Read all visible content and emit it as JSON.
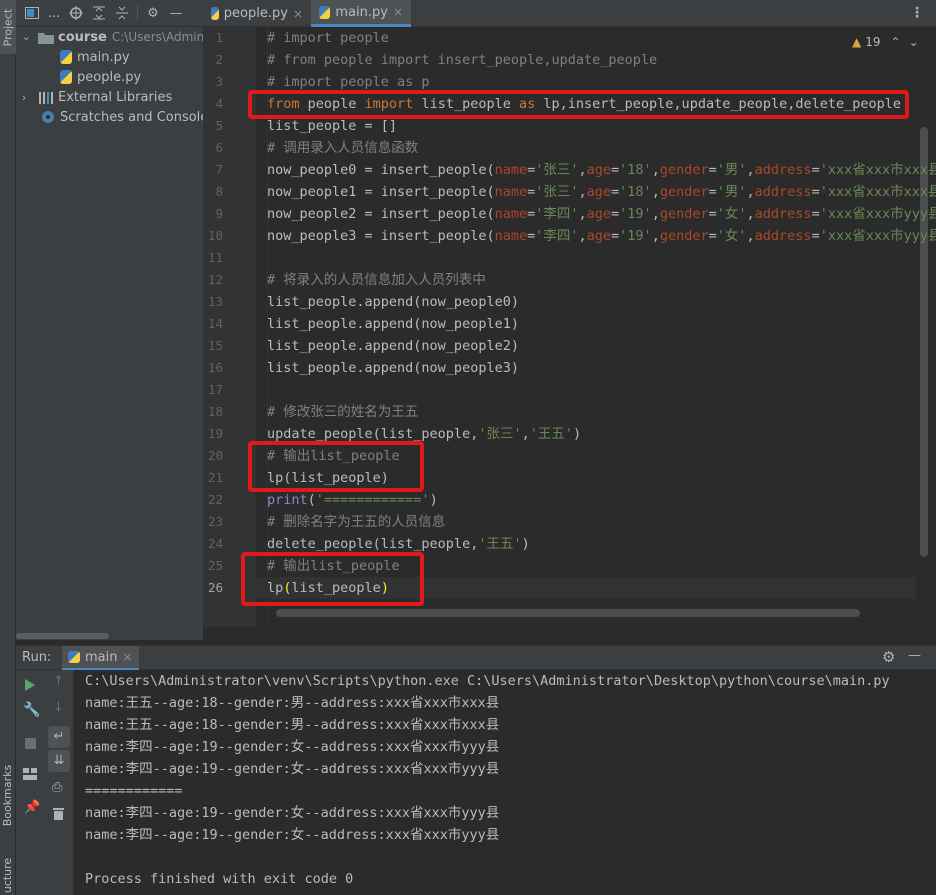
{
  "tool_strip": {
    "project_label": "Project",
    "bookmarks_label": "Bookmarks",
    "structure_label": "ucture"
  },
  "project": {
    "tree": [
      {
        "label": "course",
        "path": "C:\\Users\\Adminis"
      },
      {
        "label": "main.py"
      },
      {
        "label": "people.py"
      },
      {
        "label": "External Libraries"
      },
      {
        "label": "Scratches and Consoles"
      }
    ]
  },
  "editor": {
    "tabs": [
      {
        "label": "people.py"
      },
      {
        "label": "main.py"
      }
    ],
    "warnings_count": "19",
    "line_numbers": [
      "1",
      "2",
      "3",
      "4",
      "5",
      "6",
      "7",
      "8",
      "9",
      "10",
      "11",
      "12",
      "13",
      "14",
      "15",
      "16",
      "17",
      "18",
      "19",
      "20",
      "21",
      "22",
      "23",
      "24",
      "25",
      "26"
    ],
    "lines": [
      {
        "t": [
          [
            "cm",
            "# import people"
          ]
        ]
      },
      {
        "t": [
          [
            "cm",
            "# from people import insert_people,update_people"
          ]
        ]
      },
      {
        "t": [
          [
            "cm",
            "# import people as p"
          ]
        ]
      },
      {
        "t": [
          [
            "kw",
            "from "
          ],
          [
            "",
            "people "
          ],
          [
            "kw",
            "import "
          ],
          [
            "",
            "list_people "
          ],
          [
            "kw",
            "as "
          ],
          [
            "",
            "lp,insert_people,update_people,delete_people"
          ]
        ]
      },
      {
        "t": [
          [
            "",
            "list_people = []"
          ]
        ]
      },
      {
        "t": [
          [
            "cm",
            "# 调用录入人员信息函数"
          ]
        ]
      },
      {
        "t": [
          [
            "",
            "now_people0 = insert_people("
          ],
          [
            "pn",
            "name"
          ],
          [
            "",
            "="
          ],
          [
            "st",
            "'张三'"
          ],
          [
            "",
            ","
          ],
          [
            "pn",
            "age"
          ],
          [
            "",
            "="
          ],
          [
            "st",
            "'18'"
          ],
          [
            "",
            ","
          ],
          [
            "pn",
            "gender"
          ],
          [
            "",
            "="
          ],
          [
            "st",
            "'男'"
          ],
          [
            "",
            ","
          ],
          [
            "pn",
            "address"
          ],
          [
            "",
            "="
          ],
          [
            "st",
            "'xxx省xxx市xxx县"
          ]
        ]
      },
      {
        "t": [
          [
            "",
            "now_people1 = insert_people("
          ],
          [
            "pn",
            "name"
          ],
          [
            "",
            "="
          ],
          [
            "st",
            "'张三'"
          ],
          [
            "",
            ","
          ],
          [
            "pn",
            "age"
          ],
          [
            "",
            "="
          ],
          [
            "st",
            "'18'"
          ],
          [
            "",
            ","
          ],
          [
            "pn",
            "gender"
          ],
          [
            "",
            "="
          ],
          [
            "st",
            "'男'"
          ],
          [
            "",
            ","
          ],
          [
            "pn",
            "address"
          ],
          [
            "",
            "="
          ],
          [
            "st",
            "'xxx省xxx市xxx县"
          ]
        ]
      },
      {
        "t": [
          [
            "",
            "now_people2 = insert_people("
          ],
          [
            "pn",
            "name"
          ],
          [
            "",
            "="
          ],
          [
            "st",
            "'李四'"
          ],
          [
            "",
            ","
          ],
          [
            "pn",
            "age"
          ],
          [
            "",
            "="
          ],
          [
            "st",
            "'19'"
          ],
          [
            "",
            ","
          ],
          [
            "pn",
            "gender"
          ],
          [
            "",
            "="
          ],
          [
            "st",
            "'女'"
          ],
          [
            "",
            ","
          ],
          [
            "pn",
            "address"
          ],
          [
            "",
            "="
          ],
          [
            "st",
            "'xxx省xxx市yyy县"
          ]
        ]
      },
      {
        "t": [
          [
            "",
            "now_people3 = insert_people("
          ],
          [
            "pn",
            "name"
          ],
          [
            "",
            "="
          ],
          [
            "st",
            "'李四'"
          ],
          [
            "",
            ","
          ],
          [
            "pn",
            "age"
          ],
          [
            "",
            "="
          ],
          [
            "st",
            "'19'"
          ],
          [
            "",
            ","
          ],
          [
            "pn",
            "gender"
          ],
          [
            "",
            "="
          ],
          [
            "st",
            "'女'"
          ],
          [
            "",
            ","
          ],
          [
            "pn",
            "address"
          ],
          [
            "",
            "="
          ],
          [
            "st",
            "'xxx省xxx市yyy县"
          ]
        ]
      },
      {
        "t": []
      },
      {
        "t": [
          [
            "cm",
            "# 将录入的人员信息加入人员列表中"
          ]
        ]
      },
      {
        "t": [
          [
            "",
            "list_people.append(now_people0)"
          ]
        ]
      },
      {
        "t": [
          [
            "",
            "list_people.append(now_people1)"
          ]
        ]
      },
      {
        "t": [
          [
            "",
            "list_people.append(now_people2)"
          ]
        ]
      },
      {
        "t": [
          [
            "",
            "list_people.append(now_people3)"
          ]
        ]
      },
      {
        "t": []
      },
      {
        "t": [
          [
            "cm",
            "# 修改张三的姓名为王五"
          ]
        ]
      },
      {
        "t": [
          [
            "",
            "update_people(list_people,"
          ],
          [
            "st",
            "'张三'"
          ],
          [
            "",
            ","
          ],
          [
            "st",
            "'王五'"
          ],
          [
            "",
            ")"
          ]
        ]
      },
      {
        "t": [
          [
            "cm",
            "# 输出list_people"
          ]
        ]
      },
      {
        "t": [
          [
            "",
            "lp(list_people)"
          ]
        ]
      },
      {
        "t": [
          [
            "bi",
            "print"
          ],
          [
            "",
            "("
          ],
          [
            "st",
            "'============'"
          ],
          [
            "",
            ")"
          ]
        ]
      },
      {
        "t": [
          [
            "cm",
            "# 删除名字为王五的人员信息"
          ]
        ]
      },
      {
        "t": [
          [
            "",
            "delete_people(list_people,"
          ],
          [
            "st",
            "'王五'"
          ],
          [
            "",
            ")"
          ]
        ]
      },
      {
        "t": [
          [
            "cm",
            "# 输出list_people"
          ]
        ]
      },
      {
        "t": [
          [
            "",
            "lp"
          ],
          [
            "ht",
            "("
          ],
          [
            "",
            "list_people"
          ],
          [
            "ht",
            ")"
          ]
        ]
      }
    ]
  },
  "run": {
    "label": "Run:",
    "config": "main",
    "output": [
      "C:\\Users\\Administrator\\venv\\Scripts\\python.exe C:\\Users\\Administrator\\Desktop\\python\\course\\main.py",
      "name:王五--age:18--gender:男--address:xxx省xxx市xxx县",
      "name:王五--age:18--gender:男--address:xxx省xxx市xxx县",
      "name:李四--age:19--gender:女--address:xxx省xxx市yyy县",
      "name:李四--age:19--gender:女--address:xxx省xxx市yyy县",
      "============",
      "name:李四--age:19--gender:女--address:xxx省xxx市yyy县",
      "name:李四--age:19--gender:女--address:xxx省xxx市yyy县",
      "",
      "Process finished with exit code 0"
    ]
  },
  "colors": {
    "keyword": "#cc7832",
    "comment": "#808080",
    "string": "#6a8759",
    "param": "#aa4926",
    "highlight_box": "#e01a1a"
  }
}
